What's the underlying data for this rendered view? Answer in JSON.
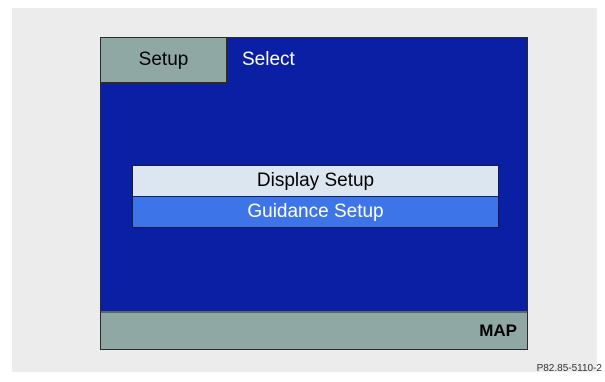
{
  "header": {
    "tab_label": "Setup",
    "title": "Select"
  },
  "menu": {
    "items": [
      {
        "label": "Display Setup",
        "selected": false
      },
      {
        "label": "Guidance Setup",
        "selected": true
      }
    ]
  },
  "footer": {
    "map_label": "MAP"
  },
  "caption": "P82.85-5110-2",
  "colors": {
    "screen_background": "#0a1fa3",
    "bar_color": "#8fa8a3",
    "menu_item_normal": "#dce6f0",
    "menu_item_selected": "#3d74e8"
  }
}
